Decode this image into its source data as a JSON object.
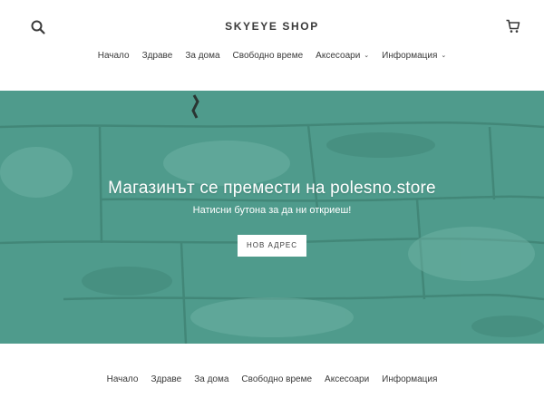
{
  "header": {
    "logo": "SKYEYE SHOP",
    "search_icon": "search-icon",
    "cart_icon": "cart-icon"
  },
  "main_nav": {
    "items": [
      {
        "label": "Начало"
      },
      {
        "label": "Здраве"
      },
      {
        "label": "За дома"
      },
      {
        "label": "Свободно време"
      },
      {
        "label": "Аксесоари",
        "has_dropdown": true
      },
      {
        "label": "Информация",
        "has_dropdown": true
      }
    ]
  },
  "hero": {
    "title": "Магазинът се премести на polesno.store",
    "subtitle": "Натисни бутона за да ни откриеш!",
    "button_label": "НОВ АДРЕС"
  },
  "footer_nav": {
    "items": [
      {
        "label": "Начало"
      },
      {
        "label": "Здраве"
      },
      {
        "label": "За дома"
      },
      {
        "label": "Свободно време"
      },
      {
        "label": "Аксесоари"
      },
      {
        "label": "Информация"
      }
    ]
  },
  "colors": {
    "hero_teal": "#4f9b8c",
    "text": "#3a3a3a",
    "white": "#ffffff"
  }
}
